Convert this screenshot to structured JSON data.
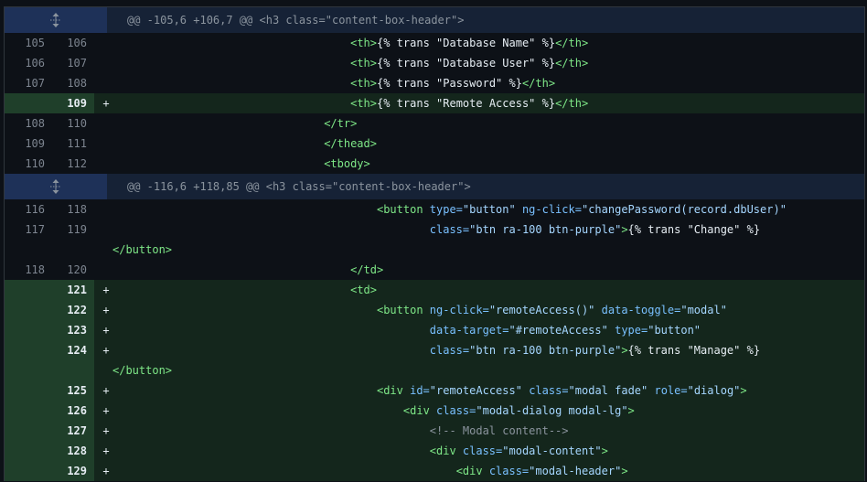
{
  "diff": {
    "rows": [
      {
        "type": "hunk",
        "text": "@@ -105,6 +106,7 @@ <h3 class=\"content-box-header\">",
        "icon": "unfold-icon"
      },
      {
        "type": "ctx",
        "old": "105",
        "new": "106",
        "indent": "                                    ",
        "tokens": [
          [
            "tag",
            "<th>"
          ],
          [
            "txt",
            "{% trans \"Database Name\" %}"
          ],
          [
            "tag",
            "</th>"
          ]
        ]
      },
      {
        "type": "ctx",
        "old": "106",
        "new": "107",
        "indent": "                                    ",
        "tokens": [
          [
            "tag",
            "<th>"
          ],
          [
            "txt",
            "{% trans \"Database User\" %}"
          ],
          [
            "tag",
            "</th>"
          ]
        ]
      },
      {
        "type": "ctx",
        "old": "107",
        "new": "108",
        "indent": "                                    ",
        "tokens": [
          [
            "tag",
            "<th>"
          ],
          [
            "txt",
            "{% trans \"Password\" %}"
          ],
          [
            "tag",
            "</th>"
          ]
        ]
      },
      {
        "type": "add",
        "old": "",
        "new": "109",
        "indent": "                                    ",
        "tokens": [
          [
            "tag",
            "<th>"
          ],
          [
            "txt",
            "{% trans \"Remote Access\" %}"
          ],
          [
            "tag",
            "</th>"
          ]
        ]
      },
      {
        "type": "ctx",
        "old": "108",
        "new": "110",
        "indent": "                                ",
        "tokens": [
          [
            "tag",
            "</tr>"
          ]
        ]
      },
      {
        "type": "ctx",
        "old": "109",
        "new": "111",
        "indent": "                                ",
        "tokens": [
          [
            "tag",
            "</thead>"
          ]
        ]
      },
      {
        "type": "ctx",
        "old": "110",
        "new": "112",
        "indent": "                                ",
        "tokens": [
          [
            "tag",
            "<tbody>"
          ]
        ]
      },
      {
        "type": "hunk",
        "text": "@@ -116,6 +118,85 @@ <h3 class=\"content-box-header\">",
        "icon": "unfold-icon"
      },
      {
        "type": "ctx",
        "old": "116",
        "new": "118",
        "indent": "                                        ",
        "tokens": [
          [
            "tag",
            "<button "
          ],
          [
            "attr",
            "type="
          ],
          [
            "str",
            "\"button\""
          ],
          [
            "txt",
            " "
          ],
          [
            "attr",
            "ng-click="
          ],
          [
            "str",
            "\"changePassword(record.dbUser)\""
          ]
        ]
      },
      {
        "type": "ctx",
        "old": "117",
        "new": "119",
        "indent": "                                                ",
        "tokens": [
          [
            "attr",
            "class="
          ],
          [
            "str",
            "\"btn ra-100 btn-purple\""
          ],
          [
            "tag",
            ">"
          ],
          [
            "txt",
            "{% trans \"Change\" %}"
          ]
        ]
      },
      {
        "type": "ctx",
        "old": "",
        "new": "",
        "indent": "",
        "tokens": [
          [
            "tag",
            "</button>"
          ]
        ]
      },
      {
        "type": "ctx",
        "old": "118",
        "new": "120",
        "indent": "                                    ",
        "tokens": [
          [
            "tag",
            "</td>"
          ]
        ]
      },
      {
        "type": "add",
        "old": "",
        "new": "121",
        "indent": "                                    ",
        "tokens": [
          [
            "tag",
            "<td>"
          ]
        ]
      },
      {
        "type": "add",
        "old": "",
        "new": "122",
        "indent": "                                        ",
        "tokens": [
          [
            "tag",
            "<button "
          ],
          [
            "attr",
            "ng-click="
          ],
          [
            "str",
            "\"remoteAccess()\""
          ],
          [
            "txt",
            " "
          ],
          [
            "attr",
            "data-toggle="
          ],
          [
            "str",
            "\"modal\""
          ]
        ]
      },
      {
        "type": "add",
        "old": "",
        "new": "123",
        "indent": "                                                ",
        "tokens": [
          [
            "attr",
            "data-target="
          ],
          [
            "str",
            "\"#remoteAccess\""
          ],
          [
            "txt",
            " "
          ],
          [
            "attr",
            "type="
          ],
          [
            "str",
            "\"button\""
          ]
        ]
      },
      {
        "type": "add",
        "old": "",
        "new": "124",
        "indent": "                                                ",
        "tokens": [
          [
            "attr",
            "class="
          ],
          [
            "str",
            "\"btn ra-100 btn-purple\""
          ],
          [
            "tag",
            ">"
          ],
          [
            "txt",
            "{% trans \"Manage\" %}"
          ]
        ]
      },
      {
        "type": "add",
        "old": "",
        "new": "",
        "indent": "",
        "tokens": [
          [
            "tag",
            "</button>"
          ]
        ]
      },
      {
        "type": "add",
        "old": "",
        "new": "125",
        "indent": "                                        ",
        "tokens": [
          [
            "tag",
            "<div "
          ],
          [
            "attr",
            "id="
          ],
          [
            "str",
            "\"remoteAccess\""
          ],
          [
            "txt",
            " "
          ],
          [
            "attr",
            "class="
          ],
          [
            "str",
            "\"modal fade\""
          ],
          [
            "txt",
            " "
          ],
          [
            "attr",
            "role="
          ],
          [
            "str",
            "\"dialog\""
          ],
          [
            "tag",
            ">"
          ]
        ]
      },
      {
        "type": "add",
        "old": "",
        "new": "126",
        "indent": "                                            ",
        "tokens": [
          [
            "tag",
            "<div "
          ],
          [
            "attr",
            "class="
          ],
          [
            "str",
            "\"modal-dialog modal-lg\""
          ],
          [
            "tag",
            ">"
          ]
        ]
      },
      {
        "type": "add",
        "old": "",
        "new": "127",
        "indent": "                                                ",
        "tokens": [
          [
            "cmt",
            "<!-- Modal content-->"
          ]
        ]
      },
      {
        "type": "add",
        "old": "",
        "new": "128",
        "indent": "                                                ",
        "tokens": [
          [
            "tag",
            "<div "
          ],
          [
            "attr",
            "class="
          ],
          [
            "str",
            "\"modal-content\""
          ],
          [
            "tag",
            ">"
          ]
        ]
      },
      {
        "type": "add",
        "old": "",
        "new": "129",
        "indent": "                                                    ",
        "tokens": [
          [
            "tag",
            "<div "
          ],
          [
            "attr",
            "class="
          ],
          [
            "str",
            "\"modal-header\""
          ],
          [
            "tag",
            ">"
          ]
        ]
      }
    ]
  }
}
